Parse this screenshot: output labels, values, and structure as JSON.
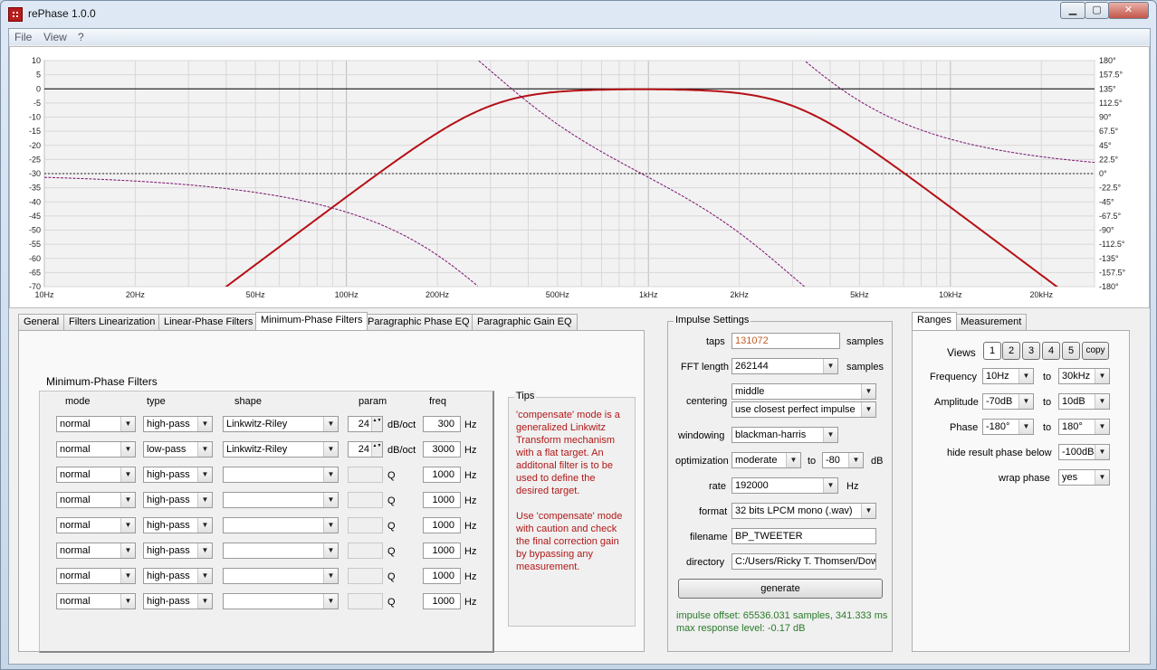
{
  "window": {
    "title": "rePhase 1.0.0",
    "buttons": {
      "minimize": "▁",
      "maximize": "▢",
      "close": "✕"
    }
  },
  "menu": [
    "File",
    "View",
    "?"
  ],
  "plot": {
    "left_ticks": [
      "10",
      "5",
      "0",
      "-5",
      "-10",
      "-15",
      "-20",
      "-25",
      "-30",
      "-35",
      "-40",
      "-45",
      "-50",
      "-55",
      "-60",
      "-65",
      "-70"
    ],
    "right_ticks": [
      "180°",
      "157.5°",
      "135°",
      "112.5°",
      "90°",
      "67.5°",
      "45°",
      "22.5°",
      "0°",
      "-22.5°",
      "-45°",
      "-67.5°",
      "-90°",
      "-112.5°",
      "-135°",
      "-157.5°",
      "-180°"
    ],
    "freq_ticks": [
      {
        "f": 10,
        "label": "10Hz"
      },
      {
        "f": 20,
        "label": "20Hz"
      },
      {
        "f": 50,
        "label": "50Hz"
      },
      {
        "f": 100,
        "label": "100Hz"
      },
      {
        "f": 200,
        "label": "200Hz"
      },
      {
        "f": 500,
        "label": "500Hz"
      },
      {
        "f": 1000,
        "label": "1kHz"
      },
      {
        "f": 2000,
        "label": "2kHz"
      },
      {
        "f": 5000,
        "label": "5kHz"
      },
      {
        "f": 10000,
        "label": "10kHz"
      },
      {
        "f": 20000,
        "label": "20kHz"
      }
    ],
    "freq_range_hz": [
      10,
      30000
    ],
    "amp_range_db": [
      -70,
      10
    ],
    "colors": {
      "magnitude": "#b50f16",
      "phase": "#7a0f6e",
      "grid": "#d8d8d8",
      "zero": "#000000"
    }
  },
  "tabs": [
    "General",
    "Filters Linearization",
    "Linear-Phase Filters",
    "Minimum-Phase Filters",
    "Paragraphic Phase EQ",
    "Paragraphic Gain EQ"
  ],
  "active_tab": "Minimum-Phase Filters",
  "minphase": {
    "group_title": "Minimum-Phase Filters",
    "headers": {
      "mode": "mode",
      "type": "type",
      "shape": "shape",
      "param": "param",
      "freq": "freq"
    },
    "rows": [
      {
        "mode": "normal",
        "type": "high-pass",
        "shape": "Linkwitz-Riley",
        "param": "24",
        "unit": "dB/oct",
        "freq": "300",
        "hz": "Hz",
        "enabled": true
      },
      {
        "mode": "normal",
        "type": "low-pass",
        "shape": "Linkwitz-Riley",
        "param": "24",
        "unit": "dB/oct",
        "freq": "3000",
        "hz": "Hz",
        "enabled": true
      },
      {
        "mode": "normal",
        "type": "high-pass",
        "shape": "",
        "param": "",
        "unit": "Q",
        "freq": "1000",
        "hz": "Hz",
        "enabled": false
      },
      {
        "mode": "normal",
        "type": "high-pass",
        "shape": "",
        "param": "",
        "unit": "Q",
        "freq": "1000",
        "hz": "Hz",
        "enabled": false
      },
      {
        "mode": "normal",
        "type": "high-pass",
        "shape": "",
        "param": "",
        "unit": "Q",
        "freq": "1000",
        "hz": "Hz",
        "enabled": false
      },
      {
        "mode": "normal",
        "type": "high-pass",
        "shape": "",
        "param": "",
        "unit": "Q",
        "freq": "1000",
        "hz": "Hz",
        "enabled": false
      },
      {
        "mode": "normal",
        "type": "high-pass",
        "shape": "",
        "param": "",
        "unit": "Q",
        "freq": "1000",
        "hz": "Hz",
        "enabled": false
      },
      {
        "mode": "normal",
        "type": "high-pass",
        "shape": "",
        "param": "",
        "unit": "Q",
        "freq": "1000",
        "hz": "Hz",
        "enabled": false
      }
    ]
  },
  "tips": {
    "title": "Tips",
    "p1": "'compensate' mode is a generalized Linkwitz Transform mechanism with a flat target. An additonal filter is to be used to define the desired target.",
    "p2": "Use 'compensate' mode with caution and check the final correction gain by bypassing any measurement."
  },
  "impulse": {
    "title": "Impulse Settings",
    "taps_label": "taps",
    "taps_value": "131072",
    "taps_unit": "samples",
    "fft_label": "FFT length",
    "fft_value": "262144",
    "fft_unit": "samples",
    "centering_label": "centering",
    "centering_value": "middle",
    "centering_option": "use closest perfect impulse",
    "windowing_label": "windowing",
    "windowing_value": "blackman-harris",
    "optimization_label": "optimization",
    "optimization_value": "moderate",
    "optimization_to": "to",
    "optimization_db_value": "-80",
    "optimization_db": "dB",
    "rate_label": "rate",
    "rate_value": "192000",
    "rate_unit": "Hz",
    "format_label": "format",
    "format_value": "32 bits LPCM mono (.wav)",
    "filename_label": "filename",
    "filename_value": "BP_TWEETER",
    "directory_label": "directory",
    "directory_value": "C:/Users/Ricky T. Thomsen/Dow",
    "generate": "generate",
    "status1": "impulse offset: 65536.031 samples, 341.333 ms",
    "status2": "max response level: -0.17 dB",
    "taps_color": "#c0602a"
  },
  "ranges_tabs": [
    "Ranges",
    "Measurement"
  ],
  "ranges": {
    "views_label": "Views",
    "views": [
      "1",
      "2",
      "3",
      "4",
      "5"
    ],
    "copy": "copy",
    "frequency_label": "Frequency",
    "freq_from": "10Hz",
    "freq_to": "30kHz",
    "amplitude_label": "Amplitude",
    "amp_from": "-70dB",
    "amp_to": "10dB",
    "phase_label": "Phase",
    "phase_from": "-180°",
    "phase_to": "180°",
    "hide_label": "hide result phase below",
    "hide_value": "-100dB",
    "wrap_label": "wrap phase",
    "wrap_value": "yes",
    "to": "to"
  }
}
